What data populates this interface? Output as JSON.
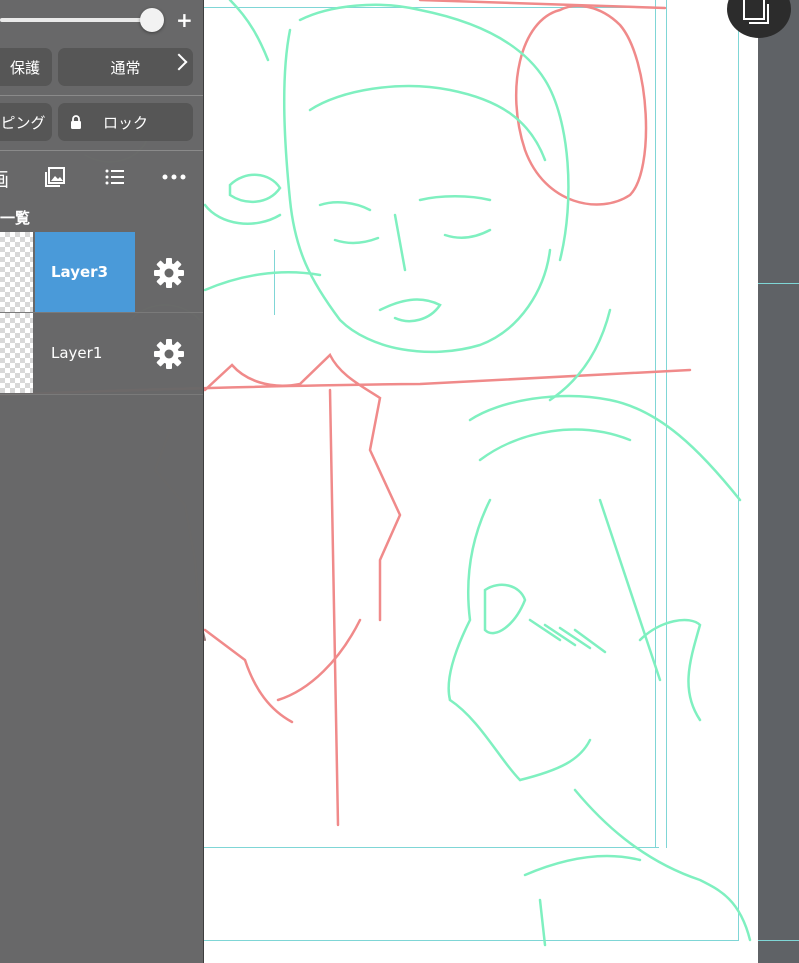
{
  "panel": {
    "blend_mode_left": "保護",
    "blend_mode": "通常",
    "clipping_label": "ピング",
    "lock_label": "ロック",
    "toolbar_partial_glyph": "画",
    "section_title": "一覧",
    "opacity_plus": "+",
    "layers": [
      {
        "name": "Layer3",
        "selected": true
      },
      {
        "name": "Layer1",
        "selected": false
      }
    ]
  },
  "icons": {
    "thumbnail": "image-icon",
    "list": "list-icon",
    "more": "more-dots-icon",
    "settings": "gear-icon",
    "lock": "lock-icon",
    "chevron": "chevron-right-icon",
    "corner": "layer-square-icon"
  },
  "colors": {
    "selected_layer": "#4a9ad9",
    "panel_bg": "#686868",
    "button_bg": "#565656",
    "sketch_green": "#7ff0c0",
    "sketch_red": "#f08a8a",
    "guide_cyan": "#7fd6d6"
  }
}
